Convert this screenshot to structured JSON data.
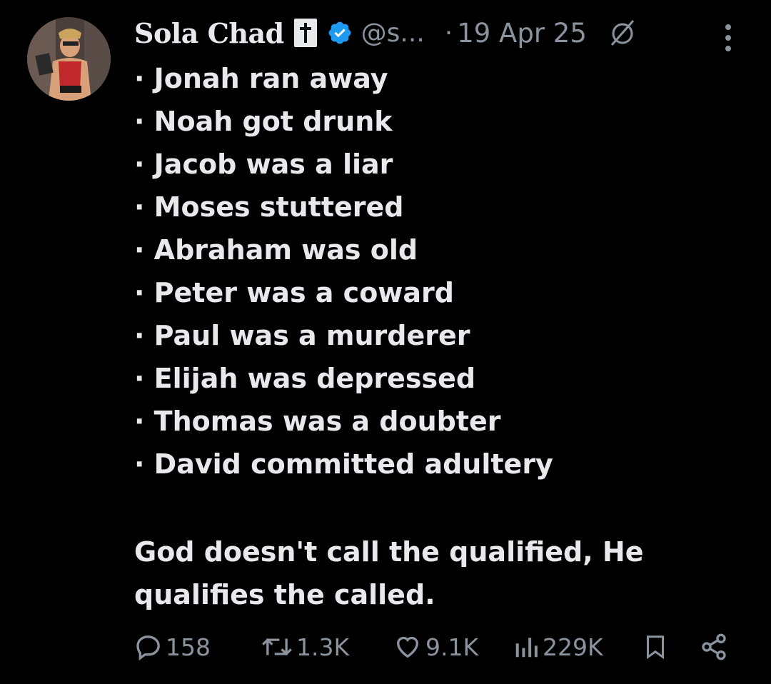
{
  "tweet": {
    "author_name": "Sola Chad",
    "handle": "@s...",
    "date": "19 Apr 25",
    "dot": "·",
    "list_items": [
      "· Jonah ran away",
      "· Noah got drunk",
      "· Jacob was a liar",
      "· Moses stuttered",
      "· Abraham was old",
      "· Peter was a coward",
      "· Paul was a murderer",
      "· Elijah was depressed",
      "· Thomas was a doubter",
      "· David committed adultery"
    ],
    "closing_line_1": "God doesn't call the qualified, He",
    "closing_line_2": "qualifies the called."
  },
  "actions": {
    "replies": "158",
    "reposts": "1.3K",
    "likes": "9.1K",
    "views": "229K"
  },
  "icons": {
    "avatar": "avatar-image",
    "badge": "cross-badge-icon",
    "verified": "verified-badge-icon",
    "grok": "grok-icon",
    "more": "more-options-icon",
    "reply": "reply-icon",
    "repost": "repost-icon",
    "like": "heart-icon",
    "views": "views-icon",
    "bookmark": "bookmark-icon",
    "share": "share-icon"
  },
  "colors": {
    "background": "#000000",
    "text": "#e7e9ea",
    "secondary": "#8b949e",
    "verified": "#1d9bf0"
  }
}
